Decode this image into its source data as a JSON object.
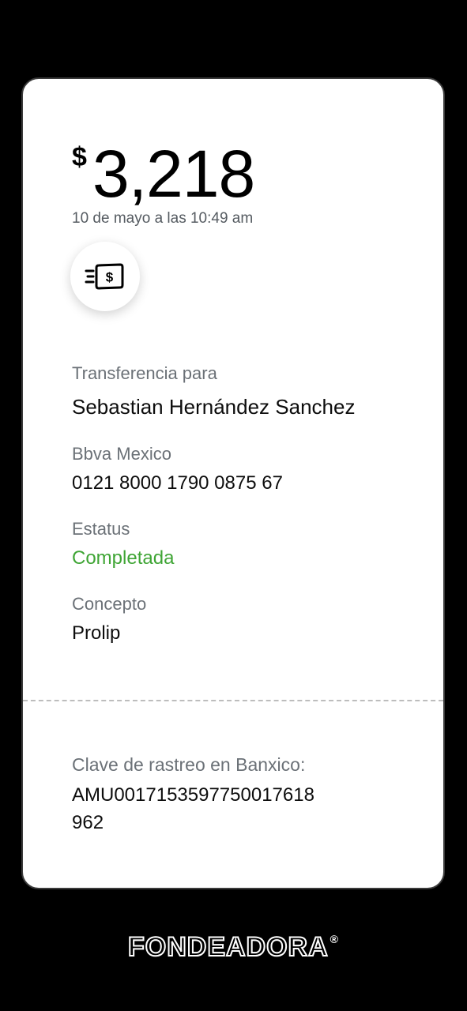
{
  "receipt": {
    "currency_symbol": "$",
    "amount": "3,218",
    "datetime": "10 de mayo a las 10:49 am",
    "transfer_icon": "cash-transfer-icon",
    "recipient_label": "Transferencia para",
    "recipient_name": "Sebastian Hernández Sanchez",
    "bank_label": "Bbva Mexico",
    "account_number": "0121 8000 1790 0875 67",
    "status_label": "Estatus",
    "status_value": "Completada",
    "concept_label": "Concepto",
    "concept_value": "Prolip",
    "tracking_label": "Clave de rastreo en Banxico:",
    "tracking_line1": "AMU0017153597750017618",
    "tracking_line2": "962"
  },
  "colors": {
    "status": "#3fa535",
    "label": "#6b7177",
    "background": "#000000",
    "card": "#ffffff"
  },
  "brand": {
    "name": "FONDEADORA",
    "registered": "®"
  }
}
